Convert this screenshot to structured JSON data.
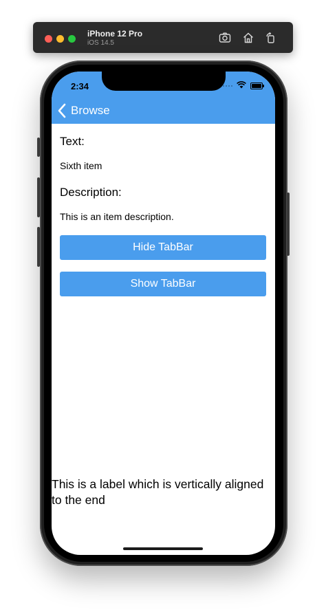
{
  "simulator": {
    "device_name": "iPhone 12 Pro",
    "os_version": "iOS 14.5",
    "icons": [
      "screenshot-icon",
      "home-icon",
      "rotate-icon"
    ]
  },
  "status_bar": {
    "time": "2:34",
    "icons": [
      "wifi-icon",
      "battery-icon"
    ]
  },
  "nav_bar": {
    "back_label": "Browse",
    "color": "#4a9ded"
  },
  "detail": {
    "text_heading": "Text:",
    "text_value": "Sixth item",
    "description_heading": "Description:",
    "description_value": "This is an item description."
  },
  "buttons": {
    "hide_tabbar": "Hide TabBar",
    "show_tabbar": "Show TabBar"
  },
  "bottom_label": "This is a label which is vertically aligned to the end",
  "colors": {
    "accent": "#4a9ded",
    "text": "#000000",
    "background": "#ffffff"
  }
}
